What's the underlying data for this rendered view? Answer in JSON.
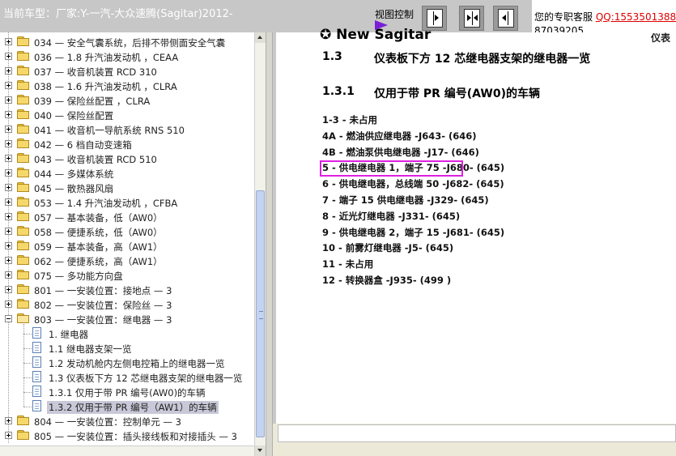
{
  "topbar": {
    "title": "当前车型：厂家:Y-一汽-大众速腾(Sagitar)2012-",
    "view_control_label": "视图控制",
    "service_text": "您的专职客服",
    "service_qq": "QQ:15535013887039205",
    "qq_line1": "QQ:1553501388",
    "qq_line2": "87039205"
  },
  "tree": {
    "items": [
      {
        "label": "034 — 安全气囊系统，后排不带侧面安全气囊",
        "type": "folder",
        "expanded": false
      },
      {
        "label": "036 — 1.8 升汽油发动机 ，CEAA",
        "type": "folder",
        "expanded": false
      },
      {
        "label": "037 — 收音机装置  RCD 310",
        "type": "folder",
        "expanded": false
      },
      {
        "label": "038 — 1.6 升汽油发动机 ，CLRA",
        "type": "folder",
        "expanded": false
      },
      {
        "label": "039 — 保险丝配置 ，CLRA",
        "type": "folder",
        "expanded": false
      },
      {
        "label": "040 — 保险丝配置",
        "type": "folder",
        "expanded": false
      },
      {
        "label": "041 — 收音机一导航系统  RNS 510",
        "type": "folder",
        "expanded": false
      },
      {
        "label": "042 — 6 档自动变速箱",
        "type": "folder",
        "expanded": false
      },
      {
        "label": "043 — 收音机装置  RCD 510",
        "type": "folder",
        "expanded": false
      },
      {
        "label": "044 — 多媒体系统",
        "type": "folder",
        "expanded": false
      },
      {
        "label": "045 — 散热器风扇",
        "type": "folder",
        "expanded": false
      },
      {
        "label": "053 — 1.4 升汽油发动机 ，CFBA",
        "type": "folder",
        "expanded": false
      },
      {
        "label": "057 — 基本装备，低（AW0）",
        "type": "folder",
        "expanded": false
      },
      {
        "label": "058 — 便捷系统，低（AW0）",
        "type": "folder",
        "expanded": false
      },
      {
        "label": "059 — 基本装备，高（AW1）",
        "type": "folder",
        "expanded": false
      },
      {
        "label": "062 — 便捷系统，高（AW1）",
        "type": "folder",
        "expanded": false
      },
      {
        "label": "075 — 多功能方向盘",
        "type": "folder",
        "expanded": false
      },
      {
        "label": "801 — 一安装位置：接地点  —  3",
        "type": "folder",
        "expanded": false
      },
      {
        "label": "802 — 一安装位置：保险丝  —  3",
        "type": "folder",
        "expanded": false
      },
      {
        "label": "803 — 一安装位置：继电器  —  3",
        "type": "folder",
        "expanded": true
      },
      {
        "label": "1. 继电器",
        "type": "doc"
      },
      {
        "label": "1.1 继电器支架一览",
        "type": "doc"
      },
      {
        "label": "1.2 发动机舱内左侧电控箱上的继电器一览",
        "type": "doc"
      },
      {
        "label": "1.3 仪表板下方  12 芯继电器支架的继电器一览",
        "type": "doc"
      },
      {
        "label": "1.3.1 仅用于带  PR 编号(AW0)的车辆",
        "type": "doc"
      },
      {
        "label": "1.3.2 仅用于带  PR 编号（AW1）的车辆",
        "type": "doc",
        "selected": true
      },
      {
        "label": "804 — 一安装位置：控制单元  —  3",
        "type": "folder",
        "expanded": false
      },
      {
        "label": "805 — 一安装位置：插头接线板和对接插头  —  3",
        "type": "folder",
        "expanded": false
      }
    ]
  },
  "content": {
    "cut_heading": "✪ New Sagitar",
    "cut_right": "仪表",
    "section_number": "1.3",
    "section_title": "仪表板下方 12 芯继电器支架的继电器一览",
    "subsection_number": "1.3.1",
    "subsection_title": "仅用于带 PR 编号(AW0)的车辆",
    "relays": [
      "1-3 - 未占用",
      "4A - 燃油供应继电器 -J643- (646)",
      "4B - 燃油泵供电继电器 -J17- (646)",
      "5 - 供电继电器 1，端子 75 -J680- (645)",
      "6 - 供电继电器，总线端 50 -J682- (645)",
      "7 - 端子 15 供电继电器 -J329- (645)",
      "8 - 近光灯继电器 -J331- (645)",
      "9 - 供电继电器 2，端子 15 -J681- (645)",
      "10 - 前雾灯继电器 -J5- (645)",
      "11 - 未占用",
      "12 - 转换器盒 -J935- (499 )"
    ],
    "highlighted_relay_index": 3
  },
  "colors": {
    "highlight_box": "#e020e0",
    "qq_link": "#e00000",
    "view_arrow": "#7a1fd8",
    "selected_tree_item": "#c8c8d8"
  },
  "icons": {
    "tree_folder": "folder-icon",
    "tree_doc": "document-icon",
    "view_buttons": [
      "collapse-left-panel-icon",
      "split-view-icon",
      "expand-left-panel-icon"
    ]
  }
}
